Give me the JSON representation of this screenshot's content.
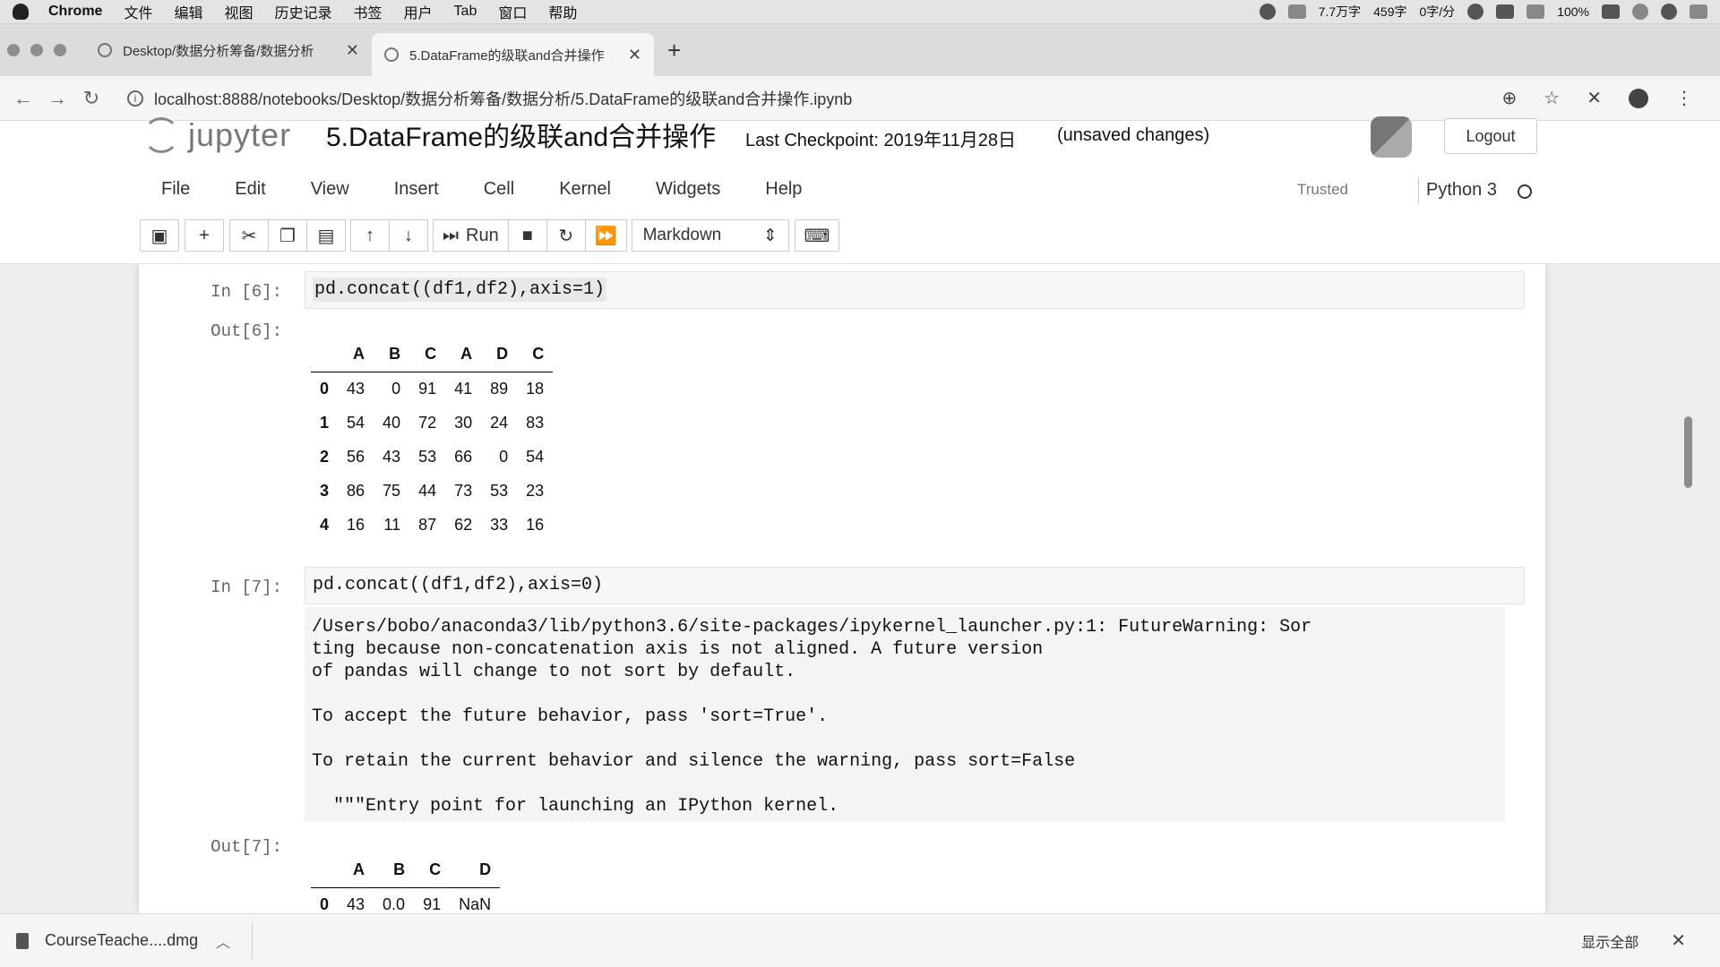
{
  "menubar": {
    "app": "Chrome",
    "items": [
      "文件",
      "编辑",
      "视图",
      "历史记录",
      "书签",
      "用户",
      "Tab",
      "窗口",
      "帮助"
    ],
    "status": [
      "7.7万字",
      "459字",
      "0字/分"
    ],
    "battery": "100%"
  },
  "tabs": [
    {
      "title": "Desktop/数据分析筹备/数据分析",
      "active": false
    },
    {
      "title": "5.DataFrame的级联and合并操作",
      "active": true
    }
  ],
  "address": {
    "url": "localhost:8888/notebooks/Desktop/数据分析筹备/数据分析/5.DataFrame的级联and合并操作.ipynb"
  },
  "jupyter": {
    "logo_text": "jupyter",
    "notebook_title": "5.DataFrame的级联and合并操作",
    "checkpoint": "Last Checkpoint: 2019年11月28日",
    "unsaved": "(unsaved changes)",
    "logout_label": "Logout",
    "menu": [
      "File",
      "Edit",
      "View",
      "Insert",
      "Cell",
      "Kernel",
      "Widgets",
      "Help"
    ],
    "trusted": "Trusted",
    "kernel": "Python 3",
    "run_label": "Run",
    "cell_type": "Markdown"
  },
  "cells": [
    {
      "in_prompt": "In [6]:",
      "code": "pd.concat((df1,df2),axis=1)",
      "out_prompt": "Out[6]:",
      "table": {
        "columns": [
          "A",
          "B",
          "C",
          "A",
          "D",
          "C"
        ],
        "rows": [
          {
            "index": "0",
            "values": [
              "43",
              "0",
              "91",
              "41",
              "89",
              "18"
            ]
          },
          {
            "index": "1",
            "values": [
              "54",
              "40",
              "72",
              "30",
              "24",
              "83"
            ]
          },
          {
            "index": "2",
            "values": [
              "56",
              "43",
              "53",
              "66",
              "0",
              "54"
            ]
          },
          {
            "index": "3",
            "values": [
              "86",
              "75",
              "44",
              "73",
              "53",
              "23"
            ]
          },
          {
            "index": "4",
            "values": [
              "16",
              "11",
              "87",
              "62",
              "33",
              "16"
            ]
          }
        ]
      }
    },
    {
      "in_prompt": "In [7]:",
      "code": "pd.concat((df1,df2),axis=0)",
      "stderr": "/Users/bobo/anaconda3/lib/python3.6/site-packages/ipykernel_launcher.py:1: FutureWarning: Sor\nting because non-concatenation axis is not aligned. A future version\nof pandas will change to not sort by default.\n\nTo accept the future behavior, pass 'sort=True'.\n\nTo retain the current behavior and silence the warning, pass sort=False\n\n  \"\"\"Entry point for launching an IPython kernel.",
      "out_prompt": "Out[7]:",
      "table": {
        "columns": [
          "A",
          "B",
          "C",
          "D"
        ],
        "rows": [
          {
            "index": "0",
            "values": [
              "43",
              "0.0",
              "91",
              "NaN"
            ]
          }
        ]
      }
    }
  ],
  "download": {
    "filename": "CourseTeache....dmg",
    "show_all": "显示全部"
  }
}
